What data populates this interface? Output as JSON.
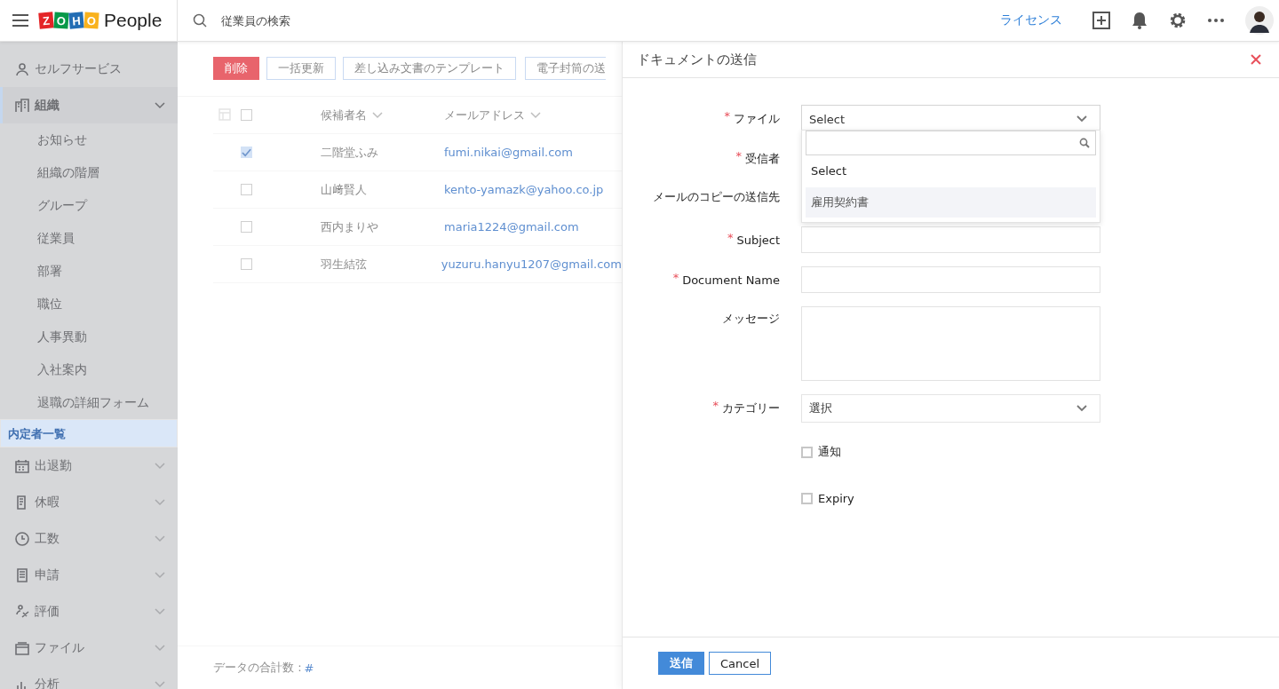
{
  "header": {
    "logo_letters": [
      "Z",
      "O",
      "H",
      "O"
    ],
    "logo_text": "People",
    "search": {
      "placeholder": "従業員の検索"
    },
    "license_link": "ライセンス"
  },
  "sidebar": {
    "items": [
      {
        "kind": "link",
        "label": "セルフサービス",
        "selected": false,
        "expanded": false
      },
      {
        "kind": "group",
        "label": "組織",
        "selected": false,
        "expanded": true,
        "children": [
          {
            "label": "お知らせ",
            "selected": false
          },
          {
            "label": "組織の階層",
            "selected": false
          },
          {
            "label": "グループ",
            "selected": false
          },
          {
            "label": "従業員",
            "selected": false
          },
          {
            "label": "部署",
            "selected": false
          },
          {
            "label": "職位",
            "selected": false
          },
          {
            "label": "人事異動",
            "selected": false
          },
          {
            "label": "入社案内",
            "selected": false
          },
          {
            "label": "退職の詳細フォーム",
            "selected": false
          },
          {
            "label": "内定者一覧",
            "selected": true
          }
        ]
      },
      {
        "kind": "group",
        "label": "出退勤",
        "selected": false,
        "expanded": false
      },
      {
        "kind": "group",
        "label": "休暇",
        "selected": false,
        "expanded": false
      },
      {
        "kind": "group",
        "label": "工数",
        "selected": false,
        "expanded": false
      },
      {
        "kind": "group",
        "label": "申請",
        "selected": false,
        "expanded": false
      },
      {
        "kind": "group",
        "label": "評価",
        "selected": false,
        "expanded": false
      },
      {
        "kind": "group",
        "label": "ファイル",
        "selected": false,
        "expanded": false
      },
      {
        "kind": "group",
        "label": "分析",
        "selected": false,
        "expanded": false
      }
    ]
  },
  "toolbar": [
    {
      "kind": "danger",
      "label": "削除"
    },
    {
      "kind": "outline",
      "label": "一括更新"
    },
    {
      "kind": "outline",
      "label": "差し込み文書のテンプレート"
    },
    {
      "kind": "outline",
      "label": "電子封筒の送"
    }
  ],
  "table": {
    "all_checked": false,
    "columns": [
      "候補者名",
      "メールアドレス"
    ],
    "rows": [
      {
        "checked": true,
        "name": "二階堂ふみ",
        "email": "fumi.nikai@gmail.com"
      },
      {
        "checked": false,
        "name": "山﨑賢人",
        "email": "kento-yamazk@yahoo.co.jp"
      },
      {
        "checked": false,
        "name": "西内まりや",
        "email": "maria1224@gmail.com"
      },
      {
        "checked": false,
        "name": "羽生結弦",
        "email": "yuzuru.hanyu1207@gmail.com"
      }
    ]
  },
  "footer": {
    "total_label": "データの合計数 :",
    "total_value": "#"
  },
  "panel": {
    "title": "ドキュメントの送信",
    "required_mark": "*",
    "fields": [
      {
        "kind": "select",
        "label": "ファイル",
        "required": true,
        "value": "Select",
        "open": true
      },
      {
        "kind": "covered",
        "label": "受信者",
        "required": true
      },
      {
        "kind": "covered",
        "label": "メールのコピーの送信先",
        "required": false
      },
      {
        "kind": "text",
        "label": "Subject",
        "required": true
      },
      {
        "kind": "text",
        "label": "Document Name",
        "required": true
      },
      {
        "kind": "textarea",
        "label": "メッセージ",
        "required": false
      },
      {
        "kind": "select",
        "label": "カテゴリー",
        "required": true,
        "value": "選択",
        "open": false
      },
      {
        "kind": "checkbox",
        "label": "通知",
        "checked": false
      },
      {
        "kind": "checkbox",
        "label": "Expiry",
        "checked": false
      }
    ],
    "dropdown": {
      "options": [
        {
          "label": "Select",
          "selected": false
        },
        {
          "label": "雇用契約書",
          "selected": true
        }
      ]
    },
    "buttons": [
      {
        "kind": "primary",
        "label": "送信"
      },
      {
        "kind": "secondary",
        "label": "Cancel"
      }
    ]
  }
}
